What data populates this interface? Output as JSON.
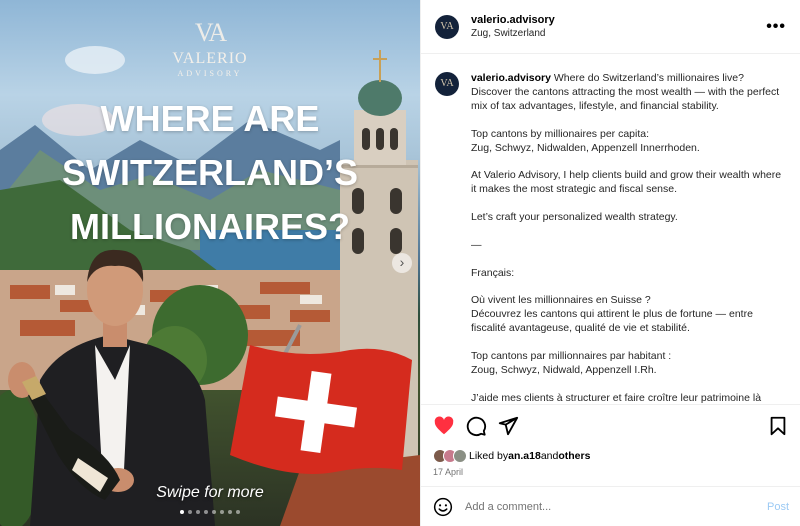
{
  "post_image": {
    "brand_monogram": "VA",
    "brand_name": "VALERIO",
    "brand_sub": "ADVISORY",
    "headline_lines": [
      "WHERE ARE",
      "SWITZERLAND’S",
      "MILLIONAIRES?"
    ],
    "swipe_text": "Swipe for more",
    "next_icon": "chevron-right-icon",
    "carousel_total": 8,
    "carousel_active": 1
  },
  "header": {
    "username": "valerio.advisory",
    "location": "Zug, Switzerland",
    "more_icon": "•••"
  },
  "caption": {
    "username": "valerio.advisory",
    "first_line": " Where do Switzerland’s millionaires live? Discover the cantons attracting the most wealth — with the perfect mix of tax advantages, lifestyle, and financial stability.",
    "paragraphs": [
      "Top cantons by millionaires per capita:\nZug, Schwyz, Nidwalden, Appenzell Innerrhoden.",
      "At Valerio Advisory, I help clients build and grow their wealth where it makes the most strategic and fiscal sense.",
      "Let’s craft your personalized wealth strategy.",
      "—",
      "Français:",
      "Où vivent les millionnaires en Suisse ?\nDécouvrez les cantons qui attirent le plus de fortune — entre fiscalité avantageuse, qualité de vie et stabilité.",
      "Top cantons par millionnaires par habitant :\nZoug, Schwyz, Nidwald, Appenzell I.Rh.",
      "J’aide mes clients à structurer et faire croître leur patrimoine là"
    ]
  },
  "actions": {
    "like_icon": "heart-icon",
    "comment_icon": "comment-icon",
    "share_icon": "share-icon",
    "save_icon": "bookmark-icon",
    "liked": true,
    "liked_by_prefix": "Liked by ",
    "liked_by_user": "an.a18",
    "liked_by_middle": " and ",
    "liked_by_others": "others",
    "date": "17 April"
  },
  "comment_box": {
    "placeholder": "Add a comment...",
    "post_label": "Post",
    "emoji_icon": "emoji-icon"
  },
  "colors": {
    "like_red": "#ff3040",
    "post_blue": "#9ccaf4",
    "avatar_navy": "#13223a",
    "flag_red": "#d52b1e"
  }
}
